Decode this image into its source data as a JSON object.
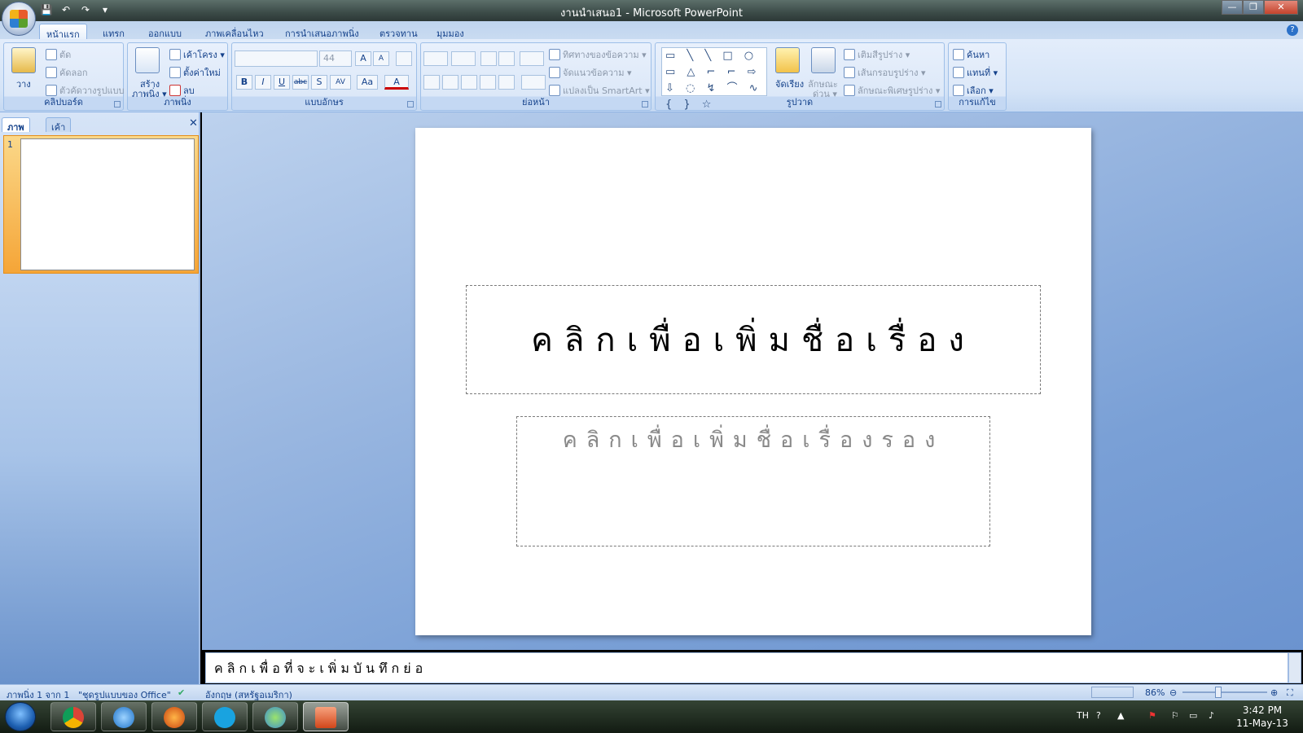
{
  "window": {
    "title": "งานนำเสนอ1 - Microsoft PowerPoint",
    "minimize": "—",
    "restore": "❐",
    "close": "✕"
  },
  "qat": {
    "save": "💾",
    "undo": "↶",
    "redo": "↷",
    "customize": "▾"
  },
  "tabs": [
    {
      "label": "หน้าแรก"
    },
    {
      "label": "แทรก"
    },
    {
      "label": "ออกแบบ"
    },
    {
      "label": "ภาพเคลื่อนไหว"
    },
    {
      "label": "การนำเสนอภาพนิ่ง"
    },
    {
      "label": "ตรวจทาน"
    },
    {
      "label": "มุมมอง"
    }
  ],
  "help": "?",
  "ribbon": {
    "clipboard": {
      "label": "คลิปบอร์ด",
      "paste": "วาง",
      "cut": "ตัด",
      "copy": "คัดลอก",
      "format_painter": "ตัวคัดวางรูปแบบ"
    },
    "slides": {
      "label": "ภาพนิ่ง",
      "new_slide": "สร้าง",
      "new_slide2": "ภาพนิ่ง ▾",
      "layout": "เค้าโครง ▾",
      "reset": "ตั้งค่าใหม่",
      "delete": "ลบ"
    },
    "font": {
      "label": "แบบอักษร",
      "size": "44",
      "grow": "A",
      "shrink": "A",
      "bold": "B",
      "italic": "I",
      "underline": "U",
      "strike": "abc",
      "shadow": "S",
      "spacing": "AV",
      "case": "Aa",
      "color": "A"
    },
    "paragraph": {
      "label": "ย่อหน้า",
      "text_direction": "ทิศทางของข้อความ ▾",
      "align_text": "จัดแนวข้อความ ▾",
      "smartart": "แปลงเป็น SmartArt ▾"
    },
    "drawing": {
      "label": "รูปวาด",
      "shapes": "▭ ╲ ╲ □ ○ ▭ △ ⌐ ⌐ ⇨ ⇩ ◌ ↯ ⌒ ∿ { } ☆",
      "arrange": "จัดเรียง",
      "quick_styles": "ลักษณะ",
      "quick_styles2": "ด่วน ▾",
      "fill": "เติมสีรูปร่าง ▾",
      "outline": "เส้นกรอบรูปร่าง ▾",
      "effects": "ลักษณะพิเศษรูปร่าง ▾"
    },
    "editing": {
      "label": "การแก้ไข",
      "find": "ค้นหา",
      "replace": "แทนที่ ▾",
      "select": "เลือก ▾"
    }
  },
  "panel": {
    "tab_slides": "ภาพนิ่ง",
    "tab_outline": "เค้าร่าง",
    "close": "✕",
    "thumb_number": "1"
  },
  "slide": {
    "title_placeholder": "คลิกเพื่อเพิ่มชื่อเรื่อง",
    "subtitle_placeholder": "คลิกเพื่อเพิ่มชื่อเรื่องรอง"
  },
  "notes": {
    "placeholder": "คลิกเพื่อที่จะเพิ่มบันทึกย่อ"
  },
  "status": {
    "slide_count": "ภาพนิ่ง 1 จาก 1",
    "theme": "\"ชุดรูปแบบของ Office\"",
    "language": "อังกฤษ (สหรัฐอเมริกา)",
    "zoom": "86%",
    "zoom_out": "⊖",
    "zoom_in": "⊕",
    "fit": "⛶"
  },
  "taskbar": {
    "lang": "TH",
    "time": "3:42 PM",
    "date": "11-May-13"
  },
  "colors": {
    "ribbon": "#dce8f8",
    "accent": "#15428b",
    "thumb_selected": "#f5a537"
  }
}
